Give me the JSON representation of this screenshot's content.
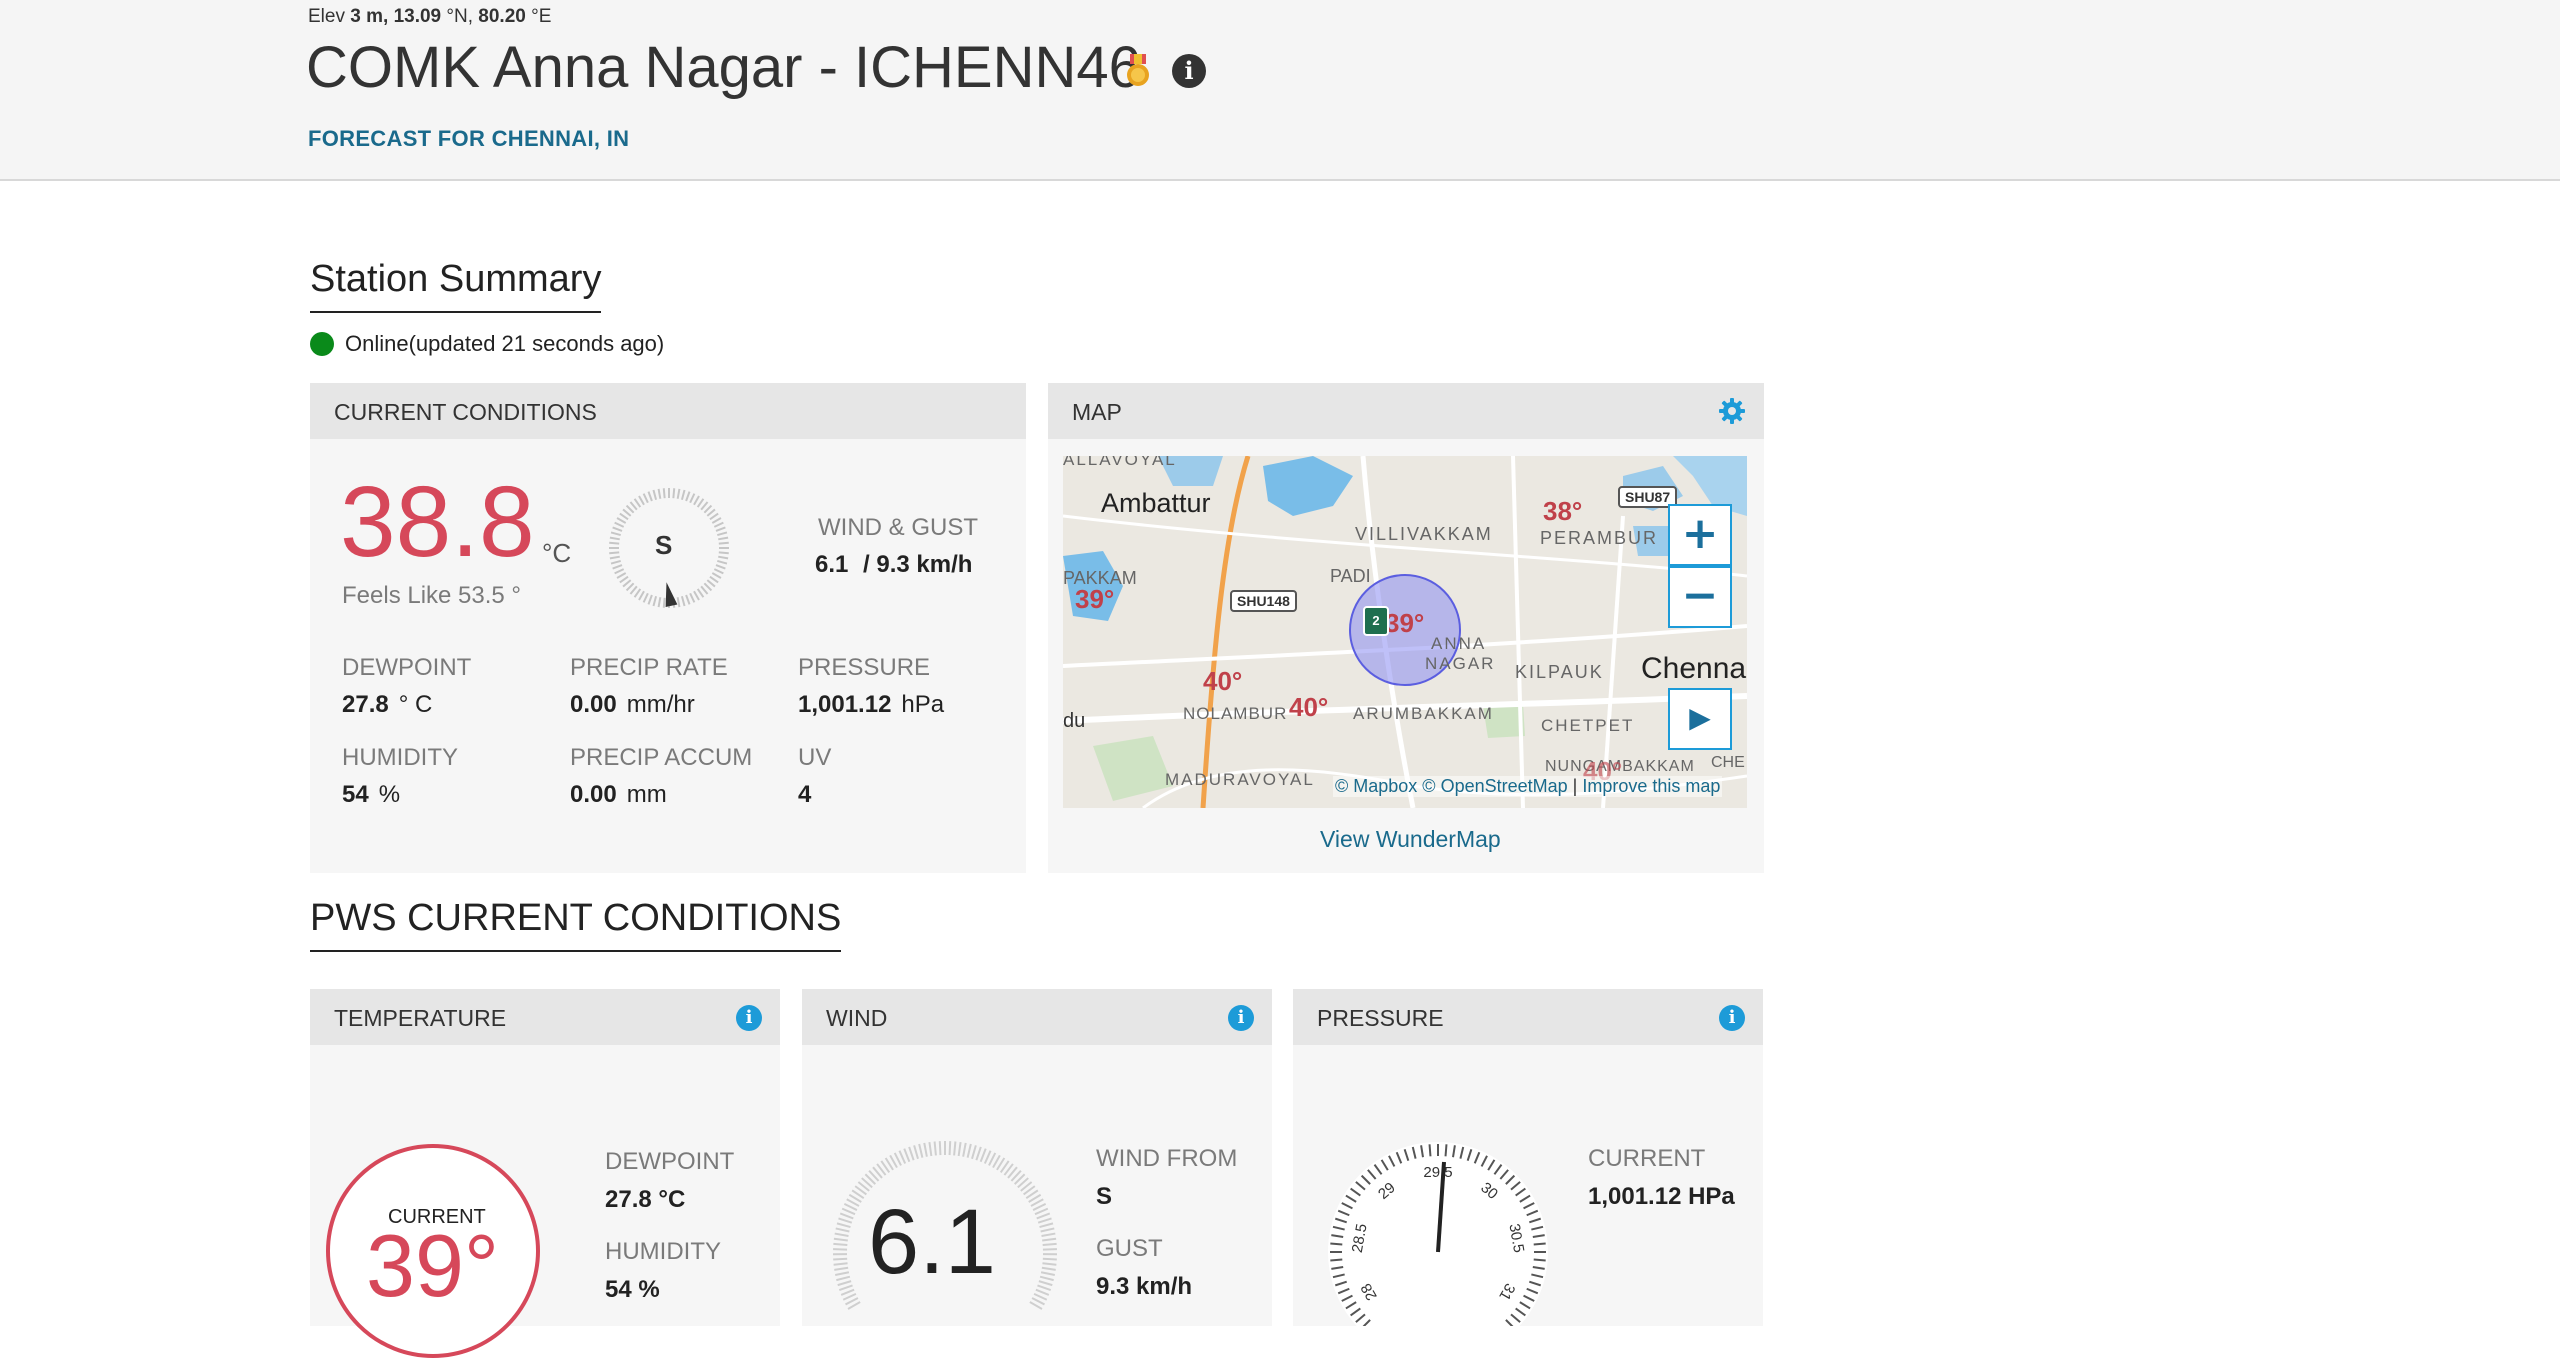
{
  "header": {
    "elev_label": "Elev",
    "elev_value": "3 m,",
    "lat": "13.09",
    "lat_unit": "°N,",
    "lon": "80.20",
    "lon_unit": "°E",
    "title": "COMK Anna Nagar - ICHENN46",
    "info": "i",
    "forecast_link": "FORECAST FOR CHENNAI, IN"
  },
  "summary": {
    "title": "Station Summary",
    "status": "Online(updated 21 seconds ago)",
    "status_color": "#0a8a1a"
  },
  "current": {
    "header": "CURRENT CONDITIONS",
    "temp": "38.8",
    "temp_unit": "°C",
    "feels_like": "Feels Like 53.5 °",
    "compass_dir": "S",
    "wind_label": "WIND & GUST",
    "wind_value": "6.1",
    "gust_value": "/ 9.3 km/h",
    "dewpoint_label": "DEWPOINT",
    "dewpoint_value": "27.8",
    "dewpoint_unit": "° C",
    "precip_rate_label": "PRECIP RATE",
    "precip_rate_value": "0.00",
    "precip_rate_unit": "mm/hr",
    "pressure_label": "PRESSURE",
    "pressure_value": "1,001.12",
    "pressure_unit": "hPa",
    "humidity_label": "HUMIDITY",
    "humidity_value": "54",
    "humidity_unit": "%",
    "precip_accum_label": "PRECIP ACCUM",
    "precip_accum_value": "0.00",
    "precip_accum_unit": "mm",
    "uv_label": "UV",
    "uv_value": "4"
  },
  "map": {
    "header": "MAP",
    "places": {
      "ambattur": "Ambattur",
      "villivakkam": "VILLIVAKKAM",
      "perambur": "PERAMBUR",
      "padi": "PADI",
      "pakkam": "PAKKAM",
      "anna1": "ANNA",
      "anna2": "NAGAR",
      "kilpauk": "KILPAUK",
      "chennai": "Chenna",
      "nolambur": "NOLAMBUR",
      "arumbakkam": "ARUMBAKKAM",
      "chetpet": "CHETPET",
      "du": "du",
      "nungambakkam": "NUNGAMBAKKAM",
      "maduravoyal": "MADURAVOYAL",
      "che": "CHE",
      "pallavoyal": "ALLAVOYAL"
    },
    "roads": {
      "shu87": "SHU87",
      "shu148": "SHU148"
    },
    "temps": {
      "t1": "38°",
      "t2": "39°",
      "t3": "40°",
      "t4": "40°",
      "t5": "39°",
      "t6": "40°"
    },
    "zoom_in": "+",
    "zoom_out": "−",
    "play": "▶",
    "attribution": "© Mapbox © OpenStreetMap",
    "improve": "Improve this map",
    "view_link": "View WunderMap",
    "station_marker": "2"
  },
  "pws": {
    "title": "PWS CURRENT CONDITIONS",
    "temperature": {
      "header": "TEMPERATURE",
      "current_label": "CURRENT",
      "current_value": "39°",
      "dewpoint_label": "DEWPOINT",
      "dewpoint_value": "27.8 °C",
      "humidity_label": "HUMIDITY",
      "humidity_value": "54 %"
    },
    "wind": {
      "header": "WIND",
      "speed": "6.1",
      "from_label": "WIND FROM",
      "from_value": "S",
      "gust_label": "GUST",
      "gust_value": "9.3 km/h"
    },
    "pressure": {
      "header": "PRESSURE",
      "current_label": "CURRENT",
      "current_value": "1,001.12 HPa",
      "dial_labels": [
        "28",
        "28.5",
        "29",
        "29.5",
        "30",
        "30.5",
        "31"
      ]
    }
  },
  "colors": {
    "accent": "#1d9bd8",
    "temp_red": "#d6485a",
    "link": "#1a6a8c"
  }
}
